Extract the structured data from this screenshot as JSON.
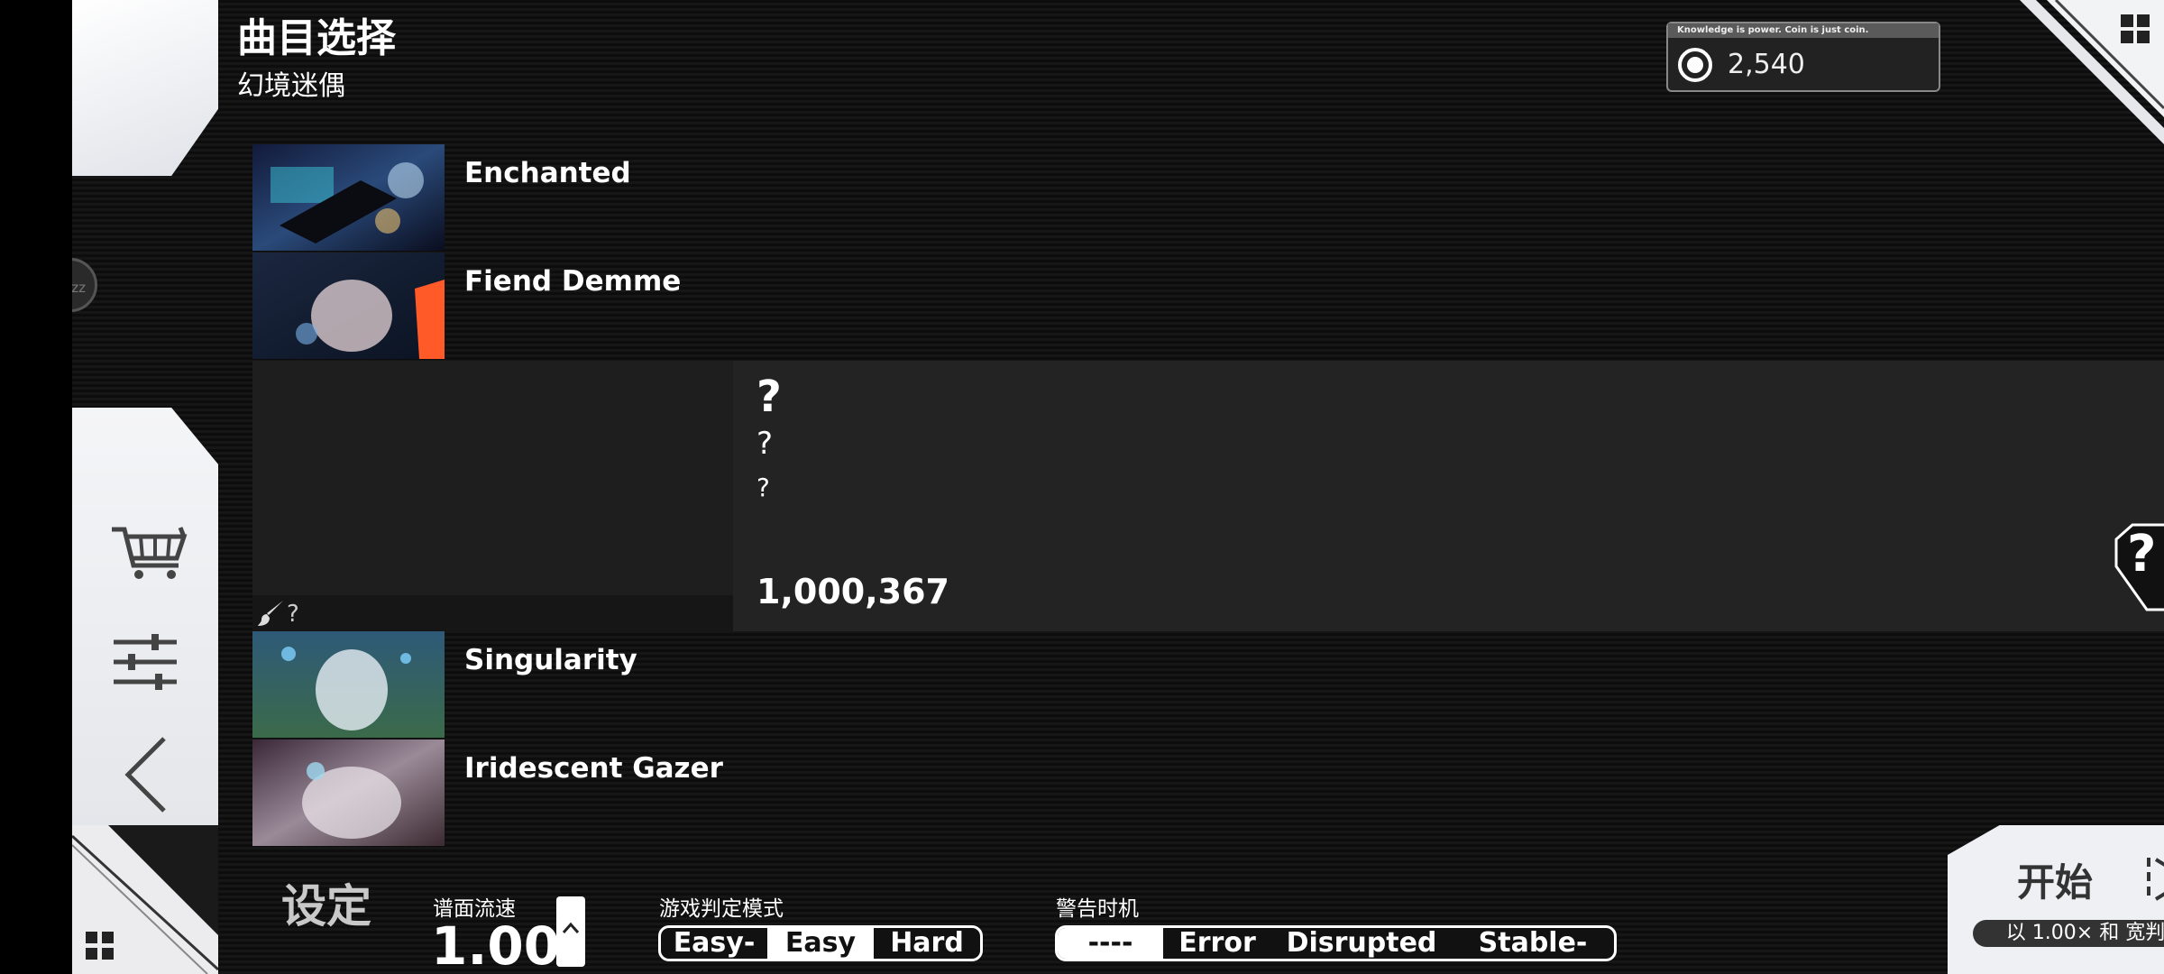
{
  "header": {
    "title": "曲目选择",
    "subtitle": "幻境迷偶"
  },
  "coins": {
    "slogan": "Knowledge is power. Coin is just coin.",
    "value": "2,540"
  },
  "sidebar": {
    "round_button_text": "zz"
  },
  "songs": [
    {
      "name": "Enchanted"
    },
    {
      "name": "Fiend Demme"
    },
    {
      "name": "Singularity"
    },
    {
      "name": "Iridescent Gazer"
    }
  ],
  "selected_song": {
    "title": "?",
    "artist": "?",
    "charter": "?",
    "illustrator": "?",
    "score": "1,000,367",
    "rank": "?",
    "rank_sub": "?"
  },
  "settings": {
    "section_title": "设定",
    "speed_label": "谱面流速",
    "speed_value": "1.00",
    "judge_label": "游戏判定模式",
    "judge_options": [
      "Easy-",
      "Easy",
      "Hard"
    ],
    "judge_selected": "Easy",
    "warn_label": "警告时机",
    "warn_options": [
      "----",
      "Error",
      "Disrupted",
      "Stable-"
    ],
    "warn_selected": "----"
  },
  "start": {
    "label": "开始",
    "sub": "以 1.00× 和 宽判"
  },
  "colors": {
    "background": "#111111",
    "panel_light": "#eef0f3",
    "selected_bg": "#262626"
  }
}
